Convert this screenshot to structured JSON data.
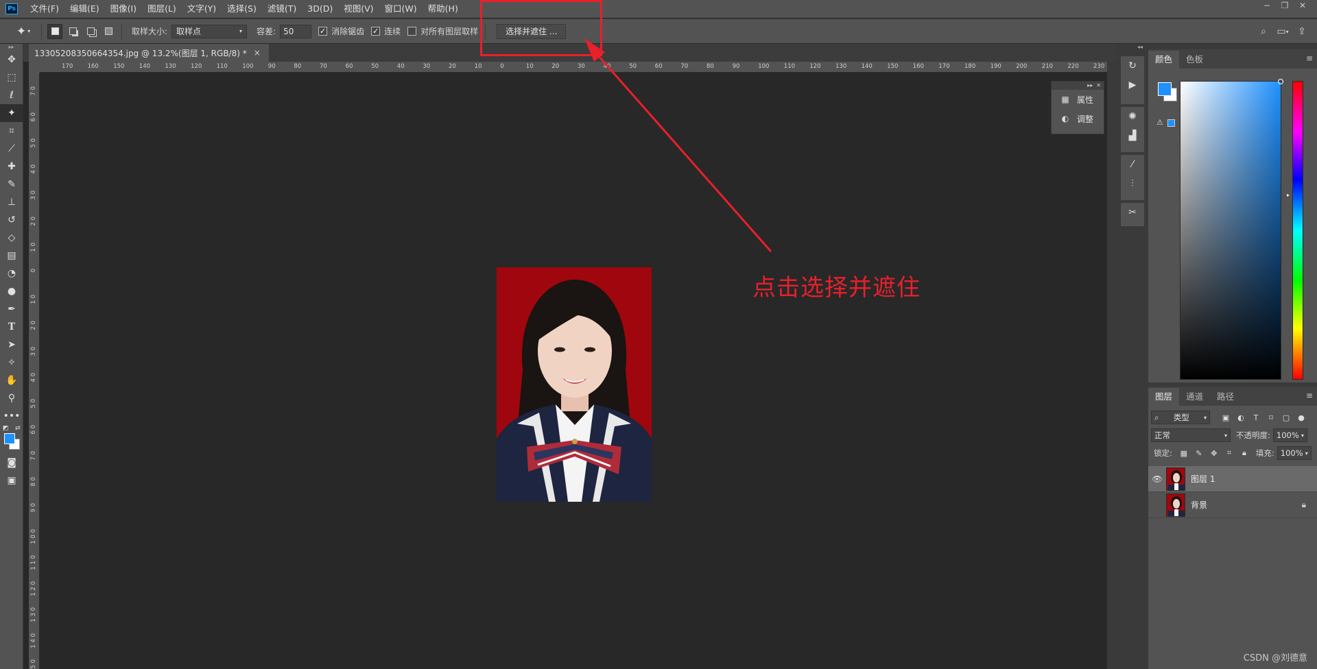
{
  "menubar": {
    "logo": "Ps",
    "items": [
      "文件(F)",
      "编辑(E)",
      "图像(I)",
      "图层(L)",
      "文字(Y)",
      "选择(S)",
      "滤镜(T)",
      "3D(D)",
      "视图(V)",
      "窗口(W)",
      "帮助(H)"
    ],
    "window_controls": [
      "−",
      "❐",
      "✕"
    ]
  },
  "options": {
    "sample_size_label": "取样大小:",
    "sample_size_value": "取样点",
    "tolerance_label": "容差:",
    "tolerance_value": "50",
    "anti_alias_label": "消除锯齿",
    "anti_alias_checked": true,
    "contiguous_label": "连续",
    "contiguous_checked": true,
    "sample_all_label": "对所有图层取样",
    "sample_all_checked": false,
    "select_mask_button": "选择并遮住 ..."
  },
  "document": {
    "tab_title": "133052083506643​54.jpg @ 13.2%(图层 1, RGB/8) *",
    "close": "×"
  },
  "ruler_h": [
    "170",
    "160",
    "150",
    "140",
    "130",
    "120",
    "110",
    "100",
    "90",
    "80",
    "70",
    "60",
    "50",
    "40",
    "30",
    "20",
    "10",
    "0",
    "10",
    "20",
    "30",
    "40",
    "50",
    "60",
    "70",
    "80",
    "90",
    "100",
    "110",
    "120",
    "130",
    "140",
    "150",
    "160",
    "170",
    "180",
    "190",
    "200",
    "210",
    "220",
    "230"
  ],
  "ruler_v": [
    "7 0",
    "6 0",
    "5 0",
    "4 0",
    "3 0",
    "2 0",
    "1 0",
    "0",
    "1 0",
    "2 0",
    "3 0",
    "4 0",
    "5 0",
    "6 0",
    "7 0",
    "8 0",
    "9 0",
    "1 0 0",
    "1 1 0",
    "1 2 0",
    "1 3 0",
    "1 4 0",
    "1 5 0"
  ],
  "float_panel": {
    "items": [
      {
        "label": "属性",
        "icon": "properties-icon"
      },
      {
        "label": "调整",
        "icon": "adjustments-icon"
      }
    ]
  },
  "color_panel": {
    "tabs": [
      "颜色",
      "色板"
    ],
    "foreground": "#1e90ff",
    "background": "#ffffff"
  },
  "layers_panel": {
    "tabs": [
      "图层",
      "通道",
      "路径"
    ],
    "filter_type": "类型",
    "blend_mode": "正常",
    "opacity_label": "不透明度:",
    "opacity_value": "100%",
    "lock_label": "锁定:",
    "fill_label": "填充:",
    "fill_value": "100%",
    "layers": [
      {
        "name": "图层 1",
        "visible": true,
        "selected": true,
        "locked": false
      },
      {
        "name": "背景",
        "visible": false,
        "selected": false,
        "locked": true
      }
    ]
  },
  "annotation": {
    "text": "点击选择并遮住",
    "color": "#e8202a"
  },
  "watermark": "CSDN @刘德意"
}
